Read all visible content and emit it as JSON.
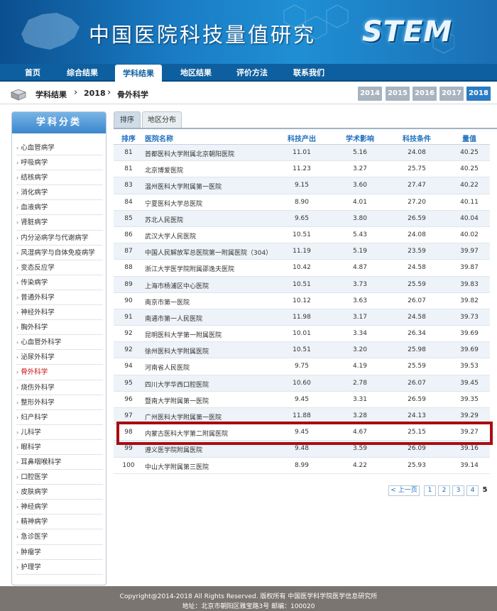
{
  "banner": {
    "title": "中国医院科技量值研究",
    "logo": "STEM"
  },
  "nav": [
    {
      "label": "首页"
    },
    {
      "label": "综合结果"
    },
    {
      "label": "学科结果",
      "active": true
    },
    {
      "label": "地区结果"
    },
    {
      "label": "评价方法"
    },
    {
      "label": "联系我们"
    }
  ],
  "breadcrumb": {
    "level1": "学科结果",
    "level2": "2018",
    "level3": "骨外科学"
  },
  "years": [
    "2014",
    "2015",
    "2016",
    "2017",
    "2018"
  ],
  "active_year": "2018",
  "sidebar": {
    "header": "学科分类",
    "items": [
      "心血管病学",
      "呼吸病学",
      "结核病学",
      "消化病学",
      "血液病学",
      "肾脏病学",
      "内分泌病学与代谢病学",
      "风湿病学与自体免疫病学",
      "变态反应学",
      "传染病学",
      "普通外科学",
      "神经外科学",
      "胸外科学",
      "心血管外科学",
      "泌尿外科学",
      "骨外科学",
      "烧伤外科学",
      "整形外科学",
      "妇产科学",
      "儿科学",
      "眼科学",
      "耳鼻咽喉科学",
      "口腔医学",
      "皮肤病学",
      "神经病学",
      "精神病学",
      "急诊医学",
      "肿瘤学",
      "护理学"
    ],
    "active": "骨外科学"
  },
  "tabs": [
    {
      "label": "排序",
      "active": true
    },
    {
      "label": "地区分布"
    }
  ],
  "table": {
    "headers": [
      "排序",
      "医院名称",
      "科技产出",
      "学术影响",
      "科技条件",
      "量值"
    ],
    "rows": [
      [
        "81",
        "首都医科大学附属北京朝阳医院",
        "11.01",
        "5.16",
        "24.08",
        "40.25"
      ],
      [
        "81",
        "北京博爱医院",
        "11.23",
        "3.27",
        "25.75",
        "40.25"
      ],
      [
        "83",
        "温州医科大学附属第一医院",
        "9.15",
        "3.60",
        "27.47",
        "40.22"
      ],
      [
        "84",
        "宁夏医科大学总医院",
        "8.90",
        "4.01",
        "27.20",
        "40.11"
      ],
      [
        "85",
        "苏北人民医院",
        "9.65",
        "3.80",
        "26.59",
        "40.04"
      ],
      [
        "86",
        "武汉大学人民医院",
        "10.51",
        "5.43",
        "24.08",
        "40.02"
      ],
      [
        "87",
        "中国人民解放军总医院第一附属医院（304）",
        "11.19",
        "5.19",
        "23.59",
        "39.97"
      ],
      [
        "88",
        "浙江大学医学院附属邵逸夫医院",
        "10.42",
        "4.87",
        "24.58",
        "39.87"
      ],
      [
        "89",
        "上海市杨浦区中心医院",
        "10.51",
        "3.73",
        "25.59",
        "39.83"
      ],
      [
        "90",
        "南京市第一医院",
        "10.12",
        "3.63",
        "26.07",
        "39.82"
      ],
      [
        "91",
        "南通市第一人民医院",
        "11.98",
        "3.17",
        "24.58",
        "39.73"
      ],
      [
        "92",
        "昆明医科大学第一附属医院",
        "10.01",
        "3.34",
        "26.34",
        "39.69"
      ],
      [
        "92",
        "徐州医科大学附属医院",
        "10.51",
        "3.20",
        "25.98",
        "39.69"
      ],
      [
        "94",
        "河南省人民医院",
        "9.75",
        "4.19",
        "25.59",
        "39.53"
      ],
      [
        "95",
        "四川大学华西口腔医院",
        "10.60",
        "2.78",
        "26.07",
        "39.45"
      ],
      [
        "96",
        "暨南大学附属第一医院",
        "9.45",
        "3.31",
        "26.59",
        "39.35"
      ],
      [
        "97",
        "广州医科大学附属第一医院",
        "11.88",
        "3.28",
        "24.13",
        "39.29"
      ],
      [
        "98",
        "内蒙古医科大学第二附属医院",
        "9.45",
        "4.67",
        "25.15",
        "39.27"
      ],
      [
        "99",
        "遵义医学院附属医院",
        "9.48",
        "3.59",
        "26.09",
        "39.16"
      ],
      [
        "100",
        "中山大学附属第三医院",
        "8.99",
        "4.22",
        "25.93",
        "39.14"
      ]
    ]
  },
  "pagination": {
    "prev": "< 上一页",
    "pages": [
      "1",
      "2",
      "3",
      "4"
    ],
    "current": "5"
  },
  "footer": {
    "line1": "Copyright@2014-2018 All Rights Reserved. 版权所有 中国医学科学院医学信息研究所",
    "line2": "地址：北京市朝阳区雅宝路3号 邮编：100020"
  },
  "colors": {
    "nav": "#0e5f9f",
    "accent": "#1f6fbf",
    "highlight_border": "#a80d12",
    "footer": "#7a7570"
  }
}
